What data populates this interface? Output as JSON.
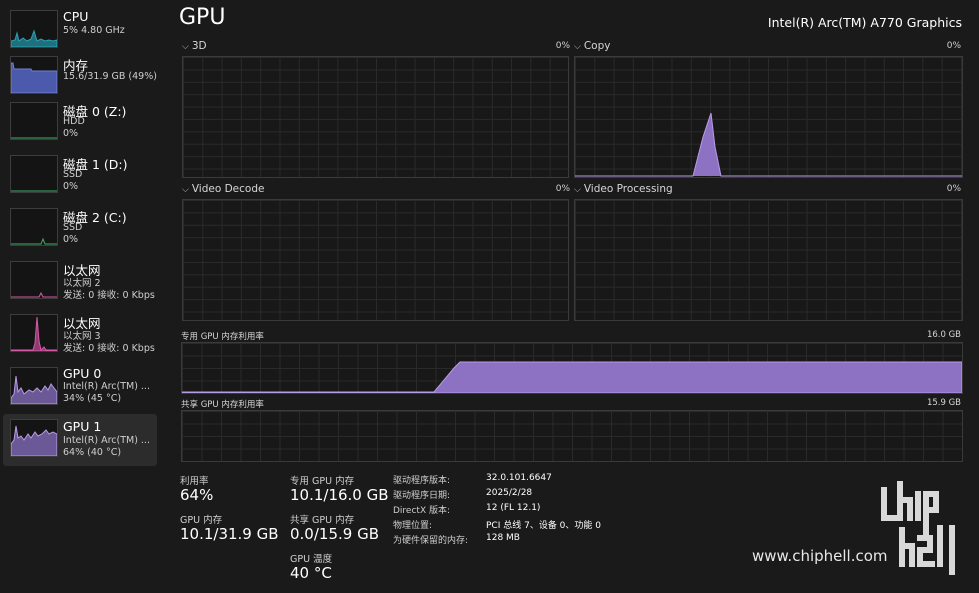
{
  "sidebar": {
    "items": [
      {
        "name": "CPU",
        "sub": [
          "5% 4.80 GHz"
        ],
        "color": "#2aa3b5"
      },
      {
        "name": "内存",
        "sub": [
          "15.6/31.9 GB (49%)"
        ],
        "color": "#6f7fd8"
      },
      {
        "name": "磁盘 0 (Z:)",
        "sub": [
          "HDD",
          "0%"
        ],
        "color": "#3fae6a"
      },
      {
        "name": "磁盘 1 (D:)",
        "sub": [
          "SSD",
          "0%"
        ],
        "color": "#3fae6a"
      },
      {
        "name": "磁盘 2 (C:)",
        "sub": [
          "SSD",
          "0%"
        ],
        "color": "#3fae6a"
      },
      {
        "name": "以太网",
        "sub": [
          "以太网 2",
          "发送: 0 接收: 0 Kbps"
        ],
        "color": "#d65aa8"
      },
      {
        "name": "以太网",
        "sub": [
          "以太网 3",
          "发送: 0 接收: 0 Kbps"
        ],
        "color": "#d65aa8"
      },
      {
        "name": "GPU 0",
        "sub": [
          "Intel(R) Arc(TM) ...",
          "34% (45 °C)"
        ],
        "color": "#9b7fd1"
      },
      {
        "name": "GPU 1",
        "sub": [
          "Intel(R) Arc(TM) ...",
          "64% (40 °C)"
        ],
        "color": "#9b7fd1",
        "active": true
      }
    ]
  },
  "header": {
    "title": "GPU",
    "model": "Intel(R) Arc(TM) A770 Graphics"
  },
  "engines": [
    {
      "label": "3D",
      "pct": "0%"
    },
    {
      "label": "Copy",
      "pct": "0%"
    },
    {
      "label": "Video Decode",
      "pct": "0%"
    },
    {
      "label": "Video Processing",
      "pct": "0%"
    }
  ],
  "memory_graphs": {
    "dedicated": {
      "label": "专用 GPU 内存利用率",
      "max": "16.0 GB"
    },
    "shared": {
      "label": "共享 GPU 内存利用率",
      "max": "15.9 GB"
    }
  },
  "stats": {
    "utilization": {
      "label": "利用率",
      "value": "64%"
    },
    "gpu_memory": {
      "label": "GPU 内存",
      "value": "10.1/31.9 GB"
    },
    "dedicated_memory": {
      "label": "专用 GPU 内存",
      "value": "10.1/16.0 GB"
    },
    "shared_memory": {
      "label": "共享 GPU 内存",
      "value": "0.0/15.9 GB"
    },
    "temperature": {
      "label": "GPU 温度",
      "value": "40 °C"
    }
  },
  "driver_info": [
    {
      "key": "驱动程序版本:",
      "value": "32.0.101.6647"
    },
    {
      "key": "驱动程序日期:",
      "value": "2025/2/28"
    },
    {
      "key": "DirectX 版本:",
      "value": "12 (FL 12.1)"
    },
    {
      "key": "物理位置:",
      "value": "PCI 总线 7、设备 0、功能 0"
    },
    {
      "key": "为硬件保留的内存:",
      "value": "128 MB"
    }
  ],
  "watermark": {
    "logo_text": "chiphell",
    "site": "www.chiphell.com"
  },
  "colors": {
    "gpu_fill": "#9b7fd1",
    "gpu_line": "#b89be6",
    "grid": "#2a2a2a",
    "border": "#3a3a3a"
  }
}
